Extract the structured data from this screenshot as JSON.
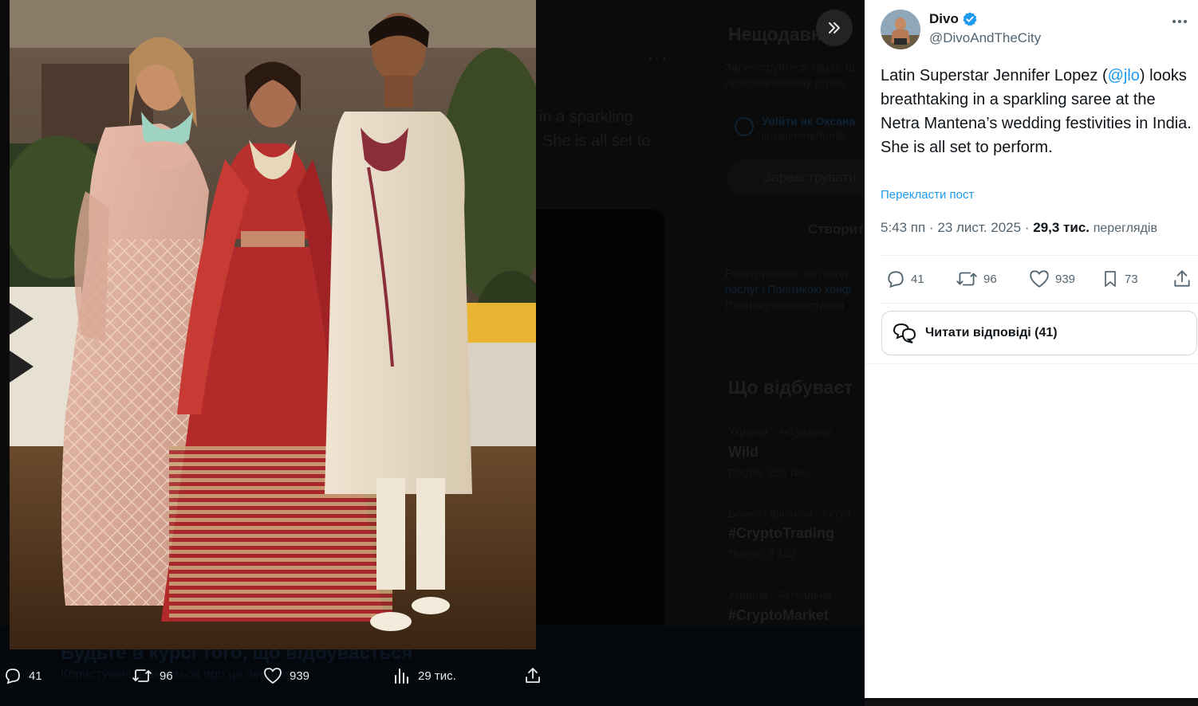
{
  "background_page": {
    "signup_heading": "Нещодавн",
    "signup_sub_1": "Зареєструйтеся зараз, щ",
    "signup_sub_2": "персоналізовану стрічк",
    "login_as": "Увійти як Оксана",
    "login_email": "iloveummerfun@",
    "register_apple": "Зареєструвати",
    "create_account": "Створит",
    "terms_1": "Реєструючись, ви погод",
    "terms_2": "послуг і Політикою конф",
    "terms_3": "Політику використання",
    "tweet_fragment_1": "in a sparkling",
    "tweet_fragment_2": "She is all set to",
    "more_dots": "···",
    "trends_heading": "Що відбуваєт",
    "trends": [
      {
        "category": "Україна · Актуальне",
        "name": "Wild",
        "posts": "Постів: 220 тис."
      },
      {
        "category": "Бізнес і фінанси · Актуа",
        "name": "#CryptoTrading",
        "posts": "Постів: 3 132"
      },
      {
        "category": "Україна · Актуальне",
        "name": "#CryptoMarket",
        "posts": ""
      }
    ],
    "banner_title": "Будьте в курсі того, що відбувається",
    "banner_sub": "Користувачі дізнаються про це першими."
  },
  "media_actions": {
    "replies": "41",
    "reposts": "96",
    "likes": "939",
    "views": "29 тис."
  },
  "tweet": {
    "display_name": "Divo",
    "handle": "@DivoAndTheCity",
    "text_before": "Latin Superstar Jennifer Lopez (",
    "mention": "@jlo",
    "text_after": ") looks breathtaking in a sparkling saree at the Netra Mantena’s wedding festivities in India. She is all set to perform.",
    "translate_label": "Перекласти пост",
    "time": "5:43 пп",
    "date": "23 лист. 2025",
    "separator": "·",
    "views_count": "29,3 тис.",
    "views_label": "переглядів",
    "stats": {
      "replies": "41",
      "reposts": "96",
      "likes": "939",
      "bookmarks": "73"
    },
    "read_replies_label": "Читати відповіді (41)"
  },
  "colors": {
    "accent": "#1d9bf0",
    "text_primary": "#0f1419",
    "text_secondary": "#536471",
    "border": "#cfd9de"
  },
  "icons": [
    "expand-icon",
    "reply-icon",
    "repost-icon",
    "like-icon",
    "views-icon",
    "share-icon",
    "bookmark-icon",
    "verified-icon",
    "more-icon",
    "replies-bubble-icon"
  ]
}
